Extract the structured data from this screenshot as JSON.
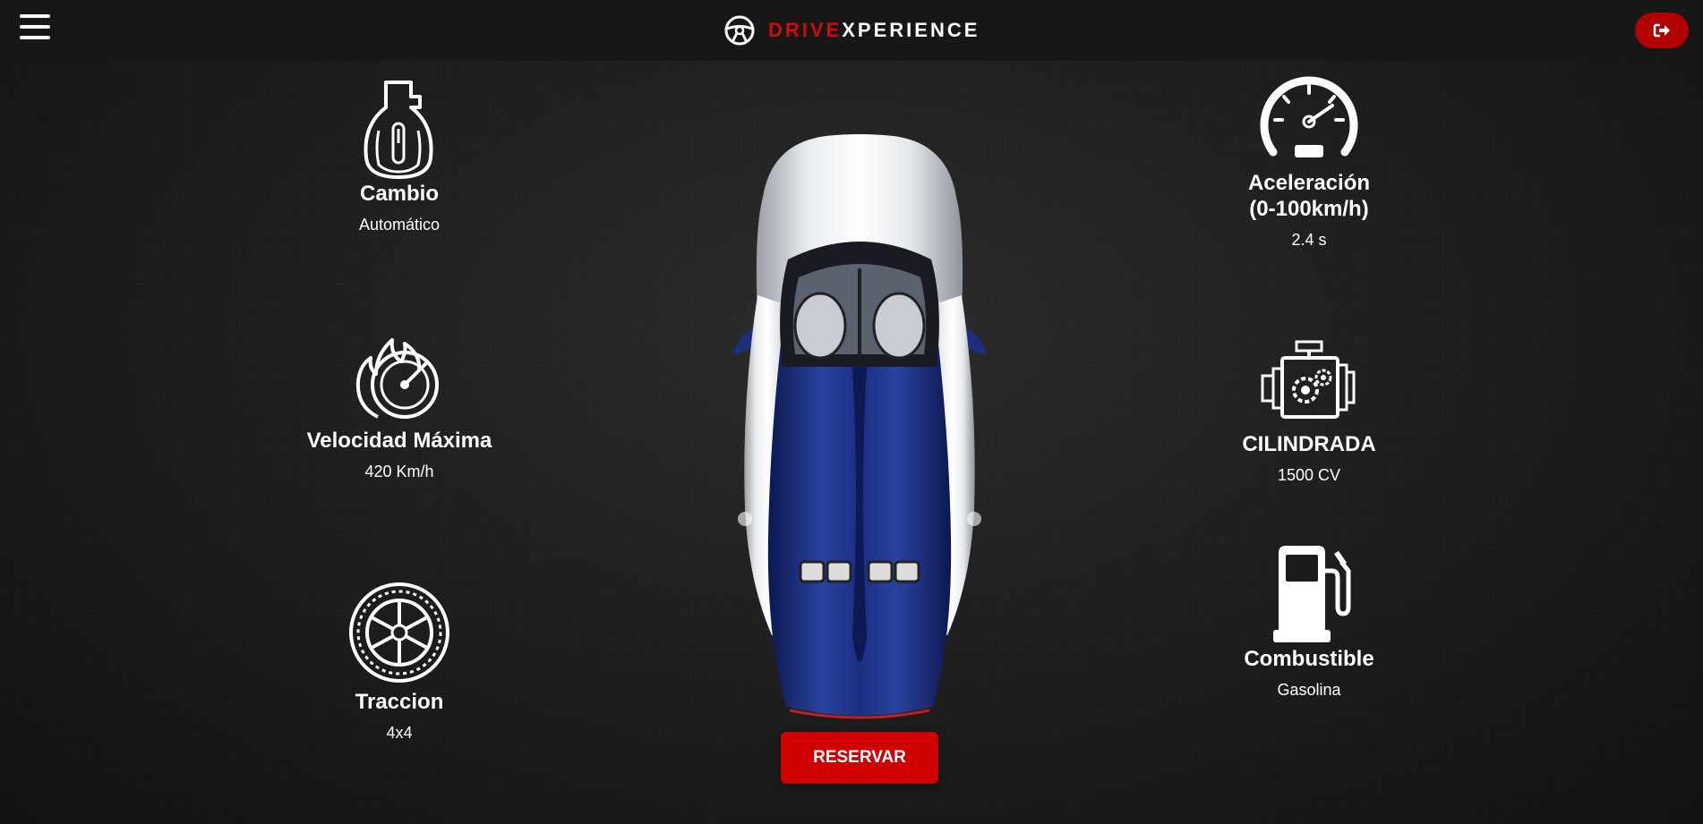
{
  "header": {
    "brand_part1": "DRIVE",
    "brand_part2": "XPERIENCE",
    "menu_icon": "hamburger-menu-icon",
    "logo_icon": "steering-wheel-icon",
    "logout_icon": "sign-out-icon"
  },
  "specs": {
    "cambio": {
      "title": "Cambio",
      "value": "Automático",
      "icon": "gear-shifter-icon"
    },
    "velocidad": {
      "title": "Velocidad Máxima",
      "value": "420 Km/h",
      "icon": "flaming-speedometer-icon"
    },
    "traccion": {
      "title": "Traccion",
      "value": "4x4",
      "icon": "wheel-icon"
    },
    "aceleracion": {
      "title_line1": "Aceleración",
      "title_line2": "(0-100km/h)",
      "value": "2.4 s",
      "icon": "speedometer-icon"
    },
    "cilindrada": {
      "title": "CILINDRADA",
      "value": "1500 CV",
      "icon": "engine-icon"
    },
    "combustible": {
      "title": "Combustible",
      "value": "Gasolina",
      "icon": "fuel-pump-icon"
    }
  },
  "actions": {
    "reserve_label": "RESERVAR"
  },
  "colors": {
    "accent": "#cf0000",
    "brand_red": "#d10a0a",
    "car_blue": "#1c2f7a",
    "car_silver": "#d8dbe0"
  }
}
